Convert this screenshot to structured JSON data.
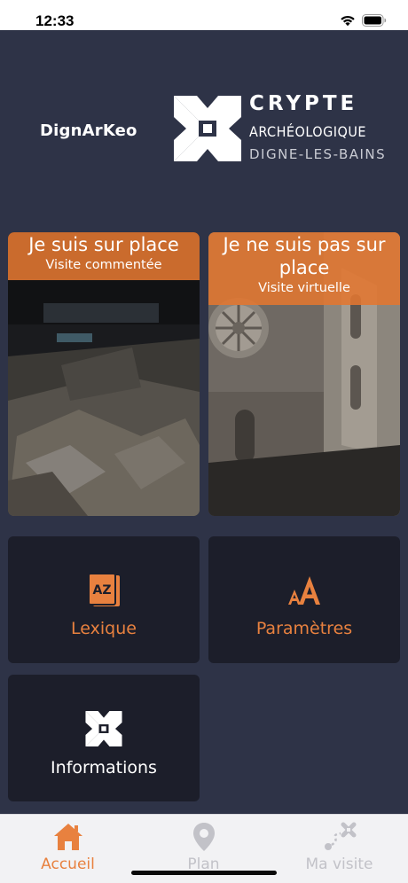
{
  "status_bar": {
    "time": "12:33",
    "icons": [
      "wifi-icon",
      "battery-icon"
    ]
  },
  "header": {
    "brand": "DignArKeo",
    "logo_title": "CRYPTE",
    "logo_subtitle": "ARCHÉOLOGIQUE",
    "logo_city": "DIGNE-LES-BAINS"
  },
  "cards": {
    "onsite": {
      "title": "Je suis sur place",
      "subtitle": "Visite commentée"
    },
    "virtual": {
      "title": "Je ne suis pas sur place",
      "subtitle": "Visite virtuelle"
    }
  },
  "tiles": {
    "lexique": {
      "label": "Lexique",
      "icon_text": "AZ",
      "icon": "dictionary-icon"
    },
    "parametres": {
      "label": "Paramètres",
      "icon": "font-size-icon"
    },
    "informations": {
      "label": "Informations",
      "icon": "crypte-logo-icon"
    }
  },
  "tab_bar": {
    "tabs": [
      {
        "label": "Accueil",
        "icon": "home-icon",
        "active": true
      },
      {
        "label": "Plan",
        "icon": "map-pin-icon",
        "active": false
      },
      {
        "label": "Ma visite",
        "icon": "route-icon",
        "active": false
      }
    ]
  },
  "colors": {
    "accent": "#e8813f",
    "background": "#2e3347",
    "tile": "#1c1e2a",
    "tab_inactive": "#c2c2c8"
  }
}
